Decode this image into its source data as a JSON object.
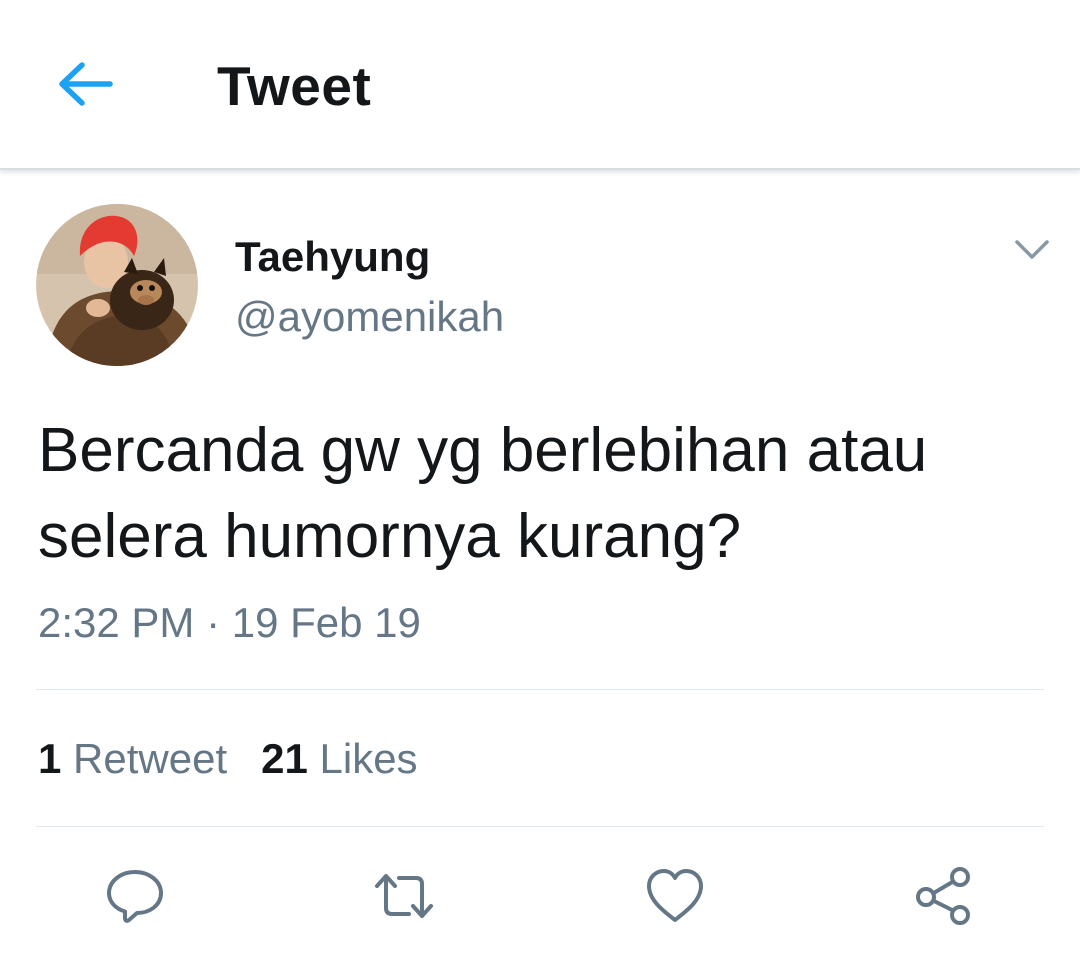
{
  "header": {
    "title": "Tweet",
    "back_icon": "arrow-left-icon",
    "accent_color": "#1da1f2"
  },
  "author": {
    "display_name": "Taehyung",
    "handle": "@ayomenikah",
    "avatar_icon": "profile-photo"
  },
  "tweet": {
    "text_lines": [
      "Bercanda gw yg berlebihan atau",
      "selera humornya kurang?"
    ],
    "timestamp": "2:32 PM · 19 Feb 19"
  },
  "stats": {
    "retweets": {
      "count": "1",
      "label": "Retweet"
    },
    "likes": {
      "count": "21",
      "label": "Likes"
    }
  },
  "actions": [
    {
      "name": "reply",
      "icon": "speech-bubble-icon"
    },
    {
      "name": "retweet",
      "icon": "retweet-arrows-icon"
    },
    {
      "name": "like",
      "icon": "heart-icon"
    },
    {
      "name": "share",
      "icon": "share-nodes-icon"
    }
  ],
  "colors": {
    "text_primary": "#14171a",
    "text_secondary": "#657786",
    "icon_gray": "#657786",
    "divider": "#e1e8ed"
  }
}
